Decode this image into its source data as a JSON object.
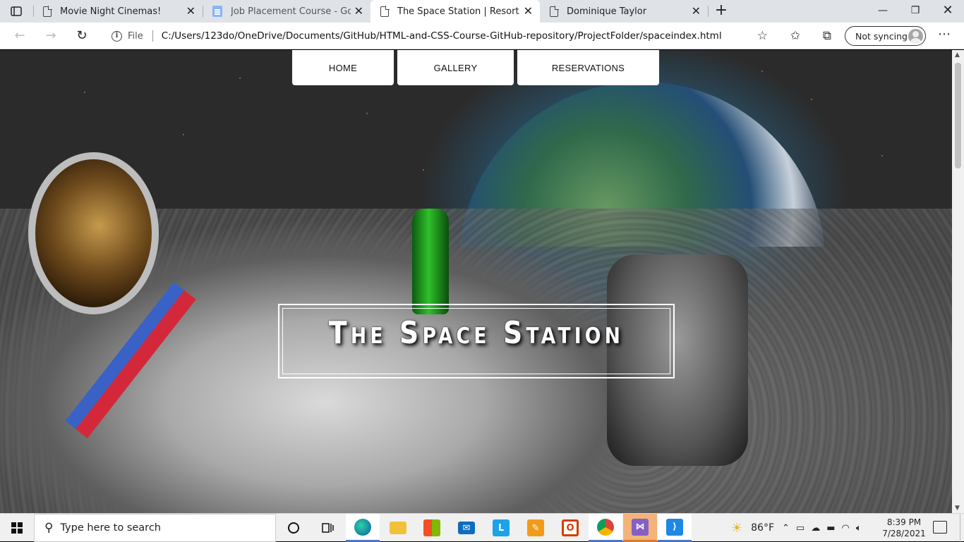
{
  "browser": {
    "tabs": [
      {
        "title": "Movie Night Cinemas!",
        "active": false
      },
      {
        "title": "Job Placement Course - Google Docs",
        "active": false
      },
      {
        "title": "The Space Station | Resort",
        "active": true
      },
      {
        "title": "Dominique Taylor",
        "active": false
      }
    ],
    "address": {
      "scheme": "File",
      "url": "C:/Users/123do/OneDrive/Documents/GitHub/HTML-and-CSS-Course-GitHub-repository/ProjectFolder/spaceindex.html"
    },
    "profile_label": "Not syncing"
  },
  "site": {
    "nav": [
      {
        "label": "HOME"
      },
      {
        "label": "GALLERY"
      },
      {
        "label": "RESERVATIONS"
      }
    ],
    "hero_title": "The Space Station"
  },
  "taskbar": {
    "search_placeholder": "Type here to search",
    "weather": "86°F",
    "time": "8:39 PM",
    "date": "7/28/2021"
  },
  "colors": {
    "taskbar_accent": "#4a76c9",
    "highlight_app": "#f3b37a"
  }
}
